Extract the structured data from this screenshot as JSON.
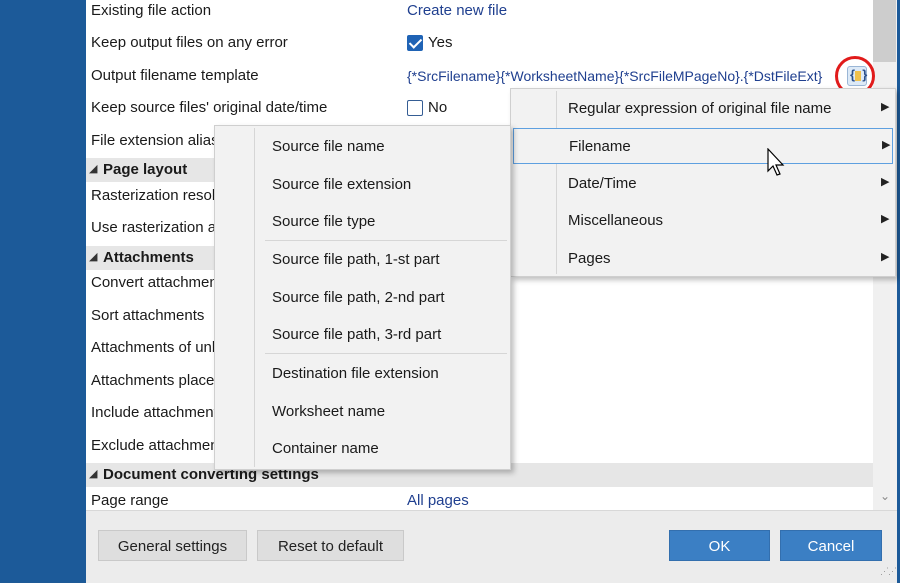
{
  "properties": {
    "rows": [
      {
        "label": "Existing file action",
        "value": "Create new file"
      },
      {
        "label": "Keep output files on any error",
        "value": "Yes"
      },
      {
        "label": "Output filename template",
        "value": "{*SrcFilename}{*WorksheetName}{*SrcFileMPageNo}.{*DstFileExt}"
      },
      {
        "label": "Keep source files' original date/time",
        "value": "No"
      },
      {
        "label": "File extension alias"
      },
      {
        "label": "Rasterization resol"
      },
      {
        "label": "Use rasterization a"
      },
      {
        "label": "Convert attachmen"
      },
      {
        "label": "Sort attachments"
      },
      {
        "label": "Attachments of unl"
      },
      {
        "label": "Attachments place"
      },
      {
        "label": "Include attachment"
      },
      {
        "label": "Exclude attachmen"
      },
      {
        "label": "Page range",
        "value": "All pages"
      }
    ],
    "sections": [
      "Page layout",
      "Attachments",
      "Document converting settings"
    ]
  },
  "macro_menu": {
    "items": [
      "Regular expression of original file name",
      "Filename",
      "Date/Time",
      "Miscellaneous",
      "Pages"
    ],
    "highlighted": "Filename"
  },
  "filename_submenu": {
    "items": [
      "Source file name",
      "Source file extension",
      "Source file type",
      "Source file path, 1-st part",
      "Source file path, 2-nd part",
      "Source file path, 3-rd part",
      "Destination file extension",
      "Worksheet name",
      "Container name"
    ]
  },
  "footer": {
    "general_settings": "General settings",
    "reset_to_default": "Reset to default",
    "ok": "OK",
    "cancel": "Cancel"
  },
  "colors": {
    "accent_blue": "#3b7fc4",
    "window_frame": "#1c5a99",
    "highlight_circle": "#e11b1b"
  }
}
